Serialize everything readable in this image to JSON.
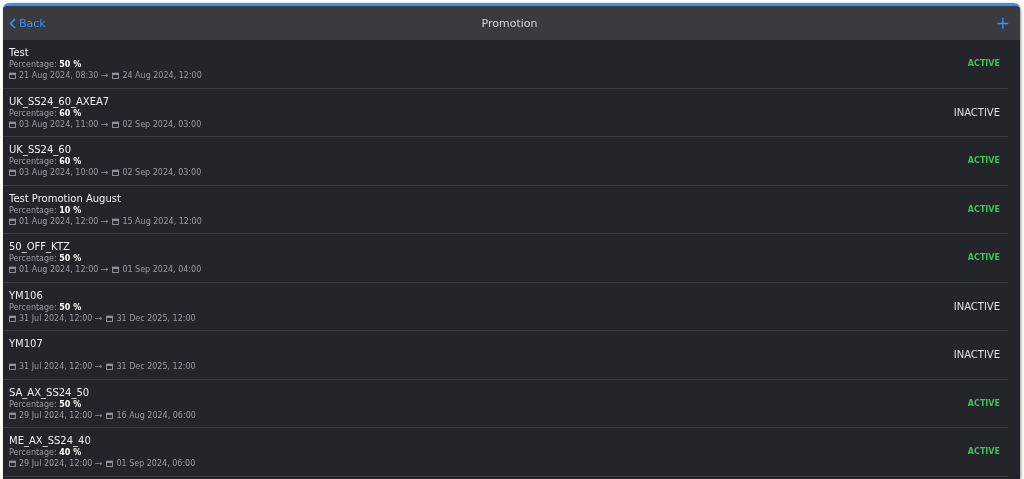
{
  "header": {
    "back": "Back",
    "title": "Promotion",
    "add": "+"
  },
  "promotions": [
    {
      "name": "Test",
      "percentage": "Percentage: **50 %**",
      "start": "21 Aug 2024, 08:30",
      "end": "24 Aug 2024, 12:00",
      "status": "ACTIVE",
      "kind": "active"
    },
    {
      "name": "UK_SS24_60_AXEA7",
      "percentage": "Percentage: **60 %**",
      "start": "03 Aug 2024, 11:00",
      "end": "02 Sep 2024, 03:00",
      "status": "INACTIVE",
      "kind": "inactive"
    },
    {
      "name": "UK_SS24_60",
      "percentage": "Percentage: **60 %**",
      "start": "03 Aug 2024, 10:00",
      "end": "02 Sep 2024, 03:00",
      "status": "ACTIVE",
      "kind": "active"
    },
    {
      "name": "Test Promotion August",
      "percentage": "Percentage: **10 %**",
      "start": "01 Aug 2024, 12:00",
      "end": "15 Aug 2024, 12:00",
      "status": "ACTIVE",
      "kind": "active"
    },
    {
      "name": "50_OFF_KTZ",
      "percentage": "Percentage: **50 %**",
      "start": "01 Aug 2024, 12:00",
      "end": "01 Sep 2024, 04:00",
      "status": "ACTIVE",
      "kind": "active"
    },
    {
      "name": "YM106",
      "percentage": "Percentage: **50 %**",
      "start": "31 Jul 2024, 12:00",
      "end": "31 Dec 2025, 12:00",
      "status": "INACTIVE",
      "kind": "inactive"
    },
    {
      "name": "YM107",
      "start": "31 Jul 2024, 12:00",
      "end": "31 Dec 2025, 12:00",
      "status": "INACTIVE",
      "kind": "inactive"
    },
    {
      "name": "SA_AX_SS24_50",
      "percentage": "Percentage: **50 %**",
      "start": "29 Jul 2024, 12:00",
      "end": "16 Aug 2024, 06:00",
      "status": "ACTIVE",
      "kind": "active"
    },
    {
      "name": "ME_AX_SS24_40",
      "percentage": "Percentage: **40 %**",
      "start": "29 Jul 2024, 12:00",
      "end": "01 Sep 2024, 06:00",
      "status": "ACTIVE",
      "kind": "active"
    }
  ]
}
